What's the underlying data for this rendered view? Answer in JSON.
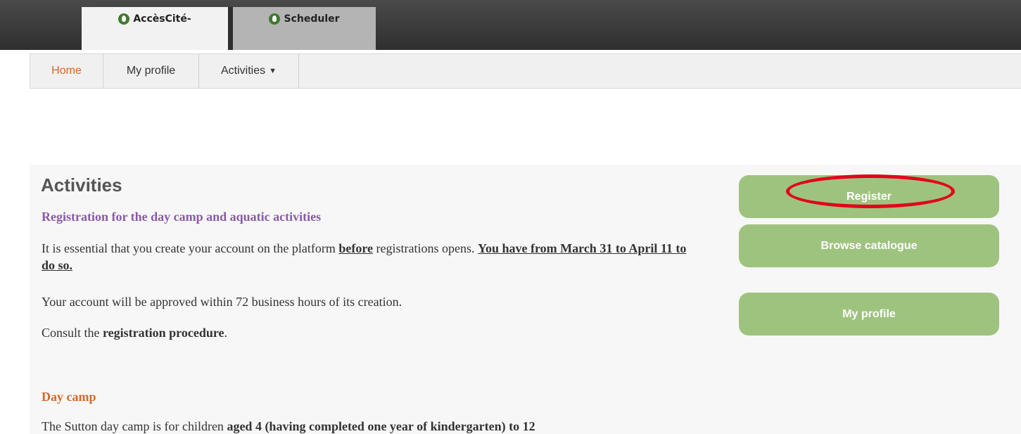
{
  "app_tabs": [
    {
      "label": "AccèsCité-",
      "active": true
    },
    {
      "label": "Scheduler",
      "active": false
    }
  ],
  "nav": {
    "home": "Home",
    "my_profile": "My profile",
    "activities": "Activities",
    "activities_caret": "▼"
  },
  "main": {
    "title": "Activities",
    "registration_heading": "Registration for the day camp and aquatic activities",
    "p1_part1": "It is essential that you create your account on the platform ",
    "p1_before": "before",
    "p1_part2": " registrations opens. ",
    "p1_deadline": "You have from March 31 to April 11 to do so.",
    "p2": "Your account will be approved within 72 business hours of its creation.",
    "p3_part1": "Consult the ",
    "p3_link": "registration procedure",
    "p3_part2": ".",
    "day_camp_heading": "Day camp",
    "p4_part1": "The Sutton day camp is for children ",
    "p4_bold": "aged 4 (having completed one year of kindergarten) to 12"
  },
  "side_buttons": {
    "register": "Register",
    "browse_catalogue": "Browse catalogue",
    "my_profile": "My profile"
  },
  "colors": {
    "button_green": "#9ec37e",
    "nav_active": "#d3692a",
    "heading_purple": "#8a5aa6",
    "heading_orange": "#d3692a",
    "annotation_red": "#e3001b"
  }
}
